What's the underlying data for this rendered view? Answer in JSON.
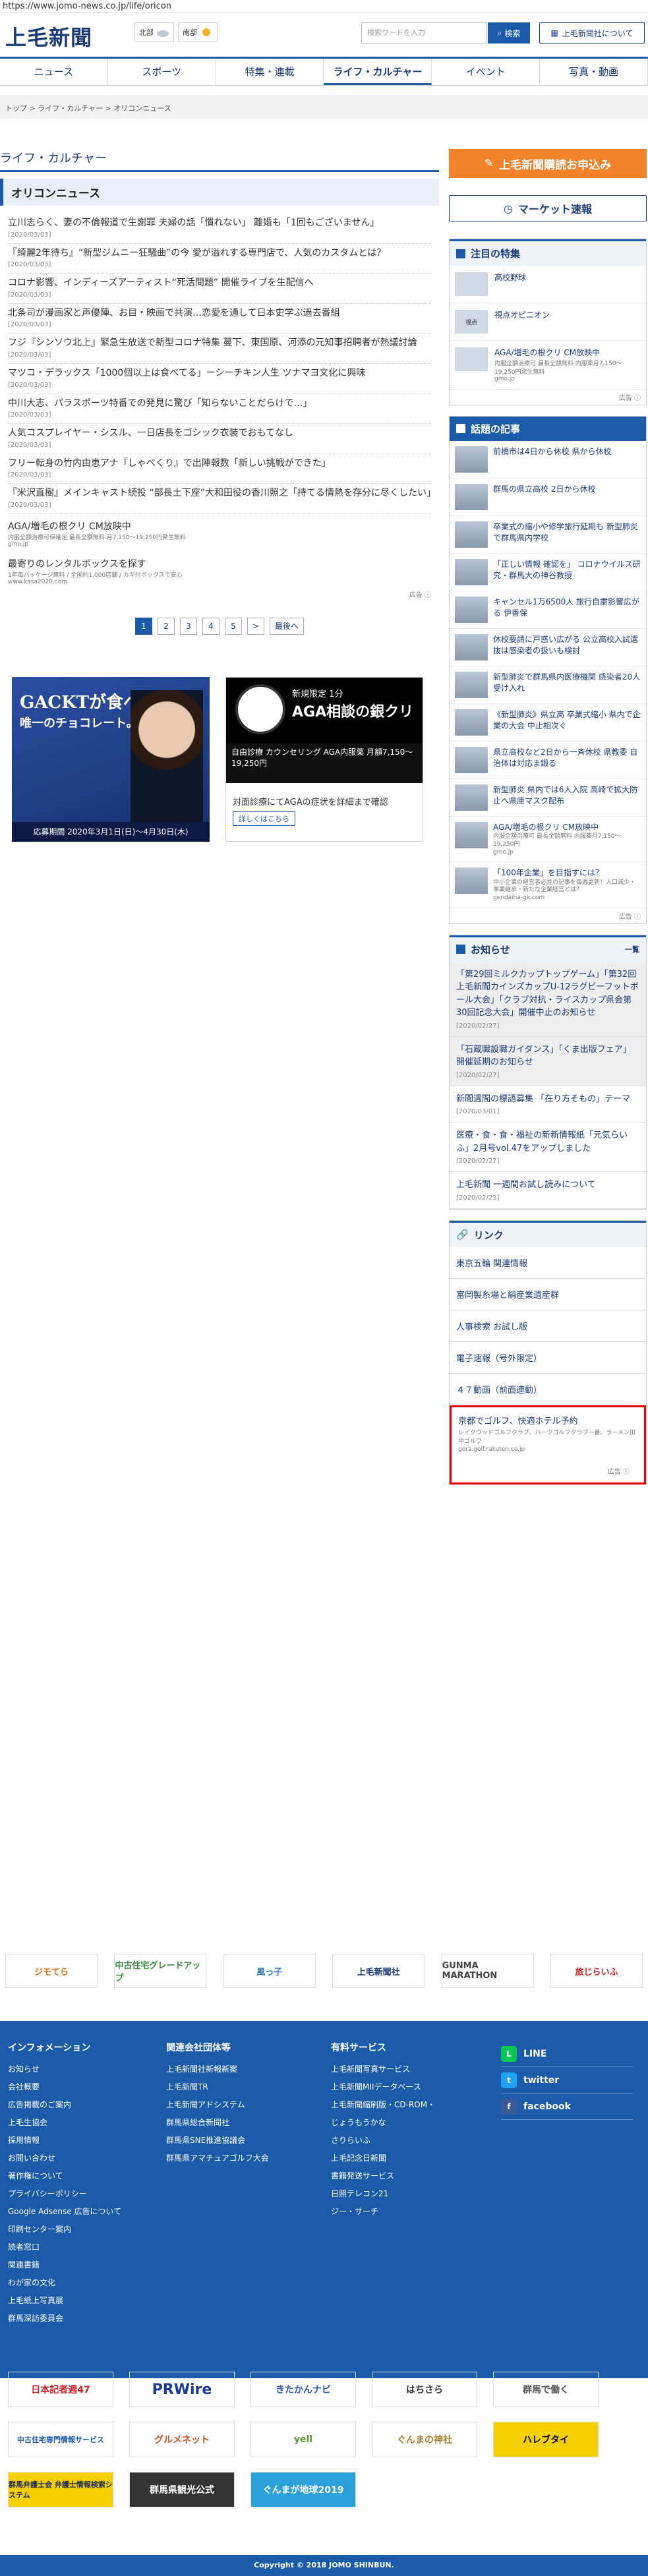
{
  "url": "https://www.jomo-news.co.jp/life/oricon",
  "logo": "上毛新聞",
  "weather": [
    {
      "area": "北部",
      "icon": "cloudy-icon"
    },
    {
      "area": "南部",
      "icon": "sunny-icon"
    }
  ],
  "search": {
    "placeholder": "検索ワードを入力",
    "button": "検索"
  },
  "about_button": "上毛新聞社について",
  "nav": [
    "ニュース",
    "スポーツ",
    "特集・連載",
    "ライフ・カルチャー",
    "イベント",
    "写真・動画"
  ],
  "breadcrumb": "トップ > ライフ・カルチャー > オリコンニュース",
  "main": {
    "section_title": "ライフ・カルチャー",
    "subhead": "オリコンニュース",
    "news": [
      {
        "title": "立川志らく、妻の不倫報道で生謝罪 夫婦の話「慣れない」 離婚も「1回もございません」",
        "date": "[2020/03/03]"
      },
      {
        "title": "『綺麗2年待ち』“新型ジムニー狂騒曲”の今 愛が溢れする専門店で、人気のカスタムとは？",
        "date": "[2020/03/03]"
      },
      {
        "title": "コロナ影響、インディーズアーティスト“死活問題” 開催ライブを生配信へ",
        "date": "[2020/03/03]"
      },
      {
        "title": "北条司が漫画家と声優陣、お目・映画で共演…恋愛を通して日本史学ぶ過去番組",
        "date": "[2020/03/03]"
      },
      {
        "title": "フジ『シンソウ北上』緊急生放送で新型コロナ特集 蔓下、東国原、河添の元知事招聘者が熱議討論",
        "date": "[2020/03/03]"
      },
      {
        "title": "マツコ・デラックス「1000個以上は食べてる」ーシーチキン人生 ツナマヨ文化に興味",
        "date": "[2020/03/03]"
      },
      {
        "title": "中川大志、パラスポーツ特番での発見に驚び「知らないことだらけで…」",
        "date": "[2020/03/03]"
      },
      {
        "title": "人気コスプレイヤー・シスル、一日店長をゴシック衣装でおもてなし",
        "date": "[2020/03/03]"
      },
      {
        "title": "フリー転身の竹内由恵アナ『しゃべくり』で出陣報数「新しい挑戦ができた」",
        "date": "[2020/03/03]"
      },
      {
        "title": "『米沢直樹』メインキャスト続投 “部長土下座”大和田役の香川照之「持てる情熱を存分に尽くしたい」",
        "date": "[2020/03/03]"
      }
    ],
    "ads": [
      {
        "title": "AGA/増毛の根クリ CM放映中",
        "sub": "内服全額治療可保確定 最長全額無料 月7,150〜19,250円発生無料",
        "src": "gmo.jp"
      },
      {
        "title": "最寄りのレンタルボックスを探す",
        "sub": "1年毎パッケージ無料 / 全国約1,000店舗 / カギ付ボックスで安心",
        "src": "www.kasa2020.com"
      }
    ],
    "ad_mark": "広告 ⓘ",
    "pager": [
      "1",
      "2",
      "3",
      "4",
      "5",
      ">",
      "最後へ"
    ],
    "banner1": {
      "h1": "GACKTが食べる",
      "h2": "唯一のチョコレート。",
      "foot": "応募期間 2020年3月1日(日)〜4月30日(木)"
    },
    "banner2": {
      "h1": "新規限定 1分",
      "h2": "AGA相談の銀クリ",
      "mid": "自由診療 カウンセリング AGA内服薬 月額7,150〜19,250円",
      "bot": "対面診療にてAGAの症状を詳細まで確認",
      "btn": "詳しくはこちら"
    }
  },
  "sidebar": {
    "subscribe_button": "上毛新聞購読お申込み",
    "market_button": "マーケット速報",
    "featured": {
      "title": "注目の特集",
      "items": [
        {
          "title": "高校野球",
          "thumb": "baseball"
        },
        {
          "title": "視点オピニオン",
          "thumb": "視点"
        },
        {
          "title": "AGA/増毛の根クリ CM放映中",
          "sub": "内服全額治療可 最長全額無料 内服薬月7,150〜19,250円発生無料",
          "src": "gmo.jp"
        }
      ]
    },
    "topics": {
      "title": "話題の記事",
      "items": [
        {
          "title": "前橋市は4日から休校 県から休校"
        },
        {
          "title": "群馬の県立高校 2日から休校"
        },
        {
          "title": "卒業式の縮小や修学旅行延期も 新型肺炎で群馬県内学校"
        },
        {
          "title": "「正しい情報 確認を」 コロナウイルス研究・群馬大の神谷教授"
        },
        {
          "title": "キャンセル1万6500人 旅行自粛影響広がる 伊香保"
        },
        {
          "title": "休校要請に戸惑い広がる 公立高校入試選抜は感染者の扱いも検討"
        },
        {
          "title": "新型肺炎で群馬県内医療機関 感染者20人受け入れ"
        },
        {
          "title": "《新型肺炎》県立高 卒業式縮小 県内で企業の大会 中止相次ぐ"
        },
        {
          "title": "県立高校など2日から一斉休校 県教委 自治体は対応ま鍛る"
        },
        {
          "title": "新型肺炎 県内では6人入院 高崎で拡大防止へ県庫マスク配布"
        },
        {
          "title": "AGA/増毛の根クリ CM放映中",
          "sub": "内服全額治療可 最長全額無料 内服薬月7,150〜19,250円",
          "src": "gmo.jp"
        },
        {
          "title": "「100年企業」を目指すには？",
          "sub": "中小企業の経営者必見の記事を毎週更新！人口減少・事業継承・新たな企業経営とは？",
          "src": "gendaiha-gk.com"
        }
      ]
    },
    "notices": {
      "title": "お知らせ",
      "more": "一覧",
      "items": [
        {
          "title": "「第29回ミルクカップトップゲーム」「第32回上毛新聞カインズカップU-12ラグビーフットボール大会」「クラブ対抗・ライスカップ県会第30回記念大会」開催中止のお知らせ",
          "date": "[2020/02/27]",
          "hl": true
        },
        {
          "title": "「石蔵職設職ガイダンス」「くま出版フェア」開催延期のお知らせ",
          "date": "[2020/02/27]",
          "hl": true
        },
        {
          "title": "新聞週間の標語募集 「在り方そもの」テーマ",
          "date": "[2020/03/01]",
          "hl": false
        },
        {
          "title": "医療・食・食・福祉の新新情報紙「元気らいふ」2月号vol.47をアップしました",
          "date": "[2020/02/27]",
          "hl": false
        },
        {
          "title": "上毛新聞 一週間お試し読みについて",
          "date": "[2020/02/23]",
          "hl": false
        }
      ]
    },
    "links": {
      "title": "リンク",
      "items": [
        "東京五輪 関連情報",
        "富岡製糸場と絹産業遺産群",
        "人事検索 お試し版",
        "電子速報（号外限定）",
        "４７動画（前面連動）"
      ]
    },
    "red_ad": {
      "title": "京都でゴルフ、快適ホテル予約",
      "sub": "レイクウッドゴルフクラブ、ハーツゴルフクラブ一番、ラーメン田中ゴルフ",
      "src": "gora.golf.rakuten.co.jp"
    }
  },
  "bottom_banners": [
    "ジモてら",
    "中古住宅グレードアップ",
    "風っ子",
    "上毛新聞社",
    "GUNMA MARATHON",
    "旅じらいふ"
  ],
  "footer": {
    "cols": [
      {
        "title": "インフォメーション",
        "items": [
          "お知らせ",
          "会社概要",
          "広告掲載のご案内",
          "上毛生協会",
          "採用情報",
          "お問い合わせ",
          "著作権について",
          "プライバシーポリシー",
          "Google Adsense 広告について",
          "印刷センター案内",
          "読者窓口",
          "関連書籍",
          "わが家の文化",
          "上毛紙上写真展",
          "群馬深訪委員会"
        ]
      },
      {
        "title": "関連会社団体等",
        "items": [
          "上毛新聞社新報新案",
          "上毛新聞TR",
          "上毛新聞アドシステム",
          "群馬県総合新聞社",
          "群馬県SNE推進協議会",
          "群馬県アマチュアゴルフ大会"
        ]
      },
      {
        "title": "有料サービス",
        "items": [
          "上毛新聞写真サービス",
          "上毛新聞MIIデータベース",
          "上毛新聞縮刷版・CD-ROM・",
          "じょうもうかな",
          "さりらいふ",
          "上毛記念日新聞",
          "書籍発送サービス",
          "日照テレコン21",
          "ジー・サーチ"
        ]
      }
    ],
    "sns": [
      {
        "name": "LINE",
        "color": "#06c755",
        "glyph": "L"
      },
      {
        "name": "twitter",
        "color": "#1da1f2",
        "glyph": "t"
      },
      {
        "name": "facebook",
        "color": "#3b5998",
        "glyph": "f"
      }
    ]
  },
  "partners": [
    [
      "日本記者週47",
      "PRWire",
      "きたかんナビ",
      "はちさら",
      "群馬で働く"
    ],
    [
      "中古住宅専門情報サービス",
      "グルメネット",
      "yell",
      "ぐんまの神社",
      "ハレブタイ"
    ],
    [
      "群馬弁護士会 弁護士情報検索システム",
      "群馬県観光公式",
      "ぐんまが地球2019"
    ]
  ],
  "copyright": "Copyright © 2018 JOMO SHINBUN."
}
